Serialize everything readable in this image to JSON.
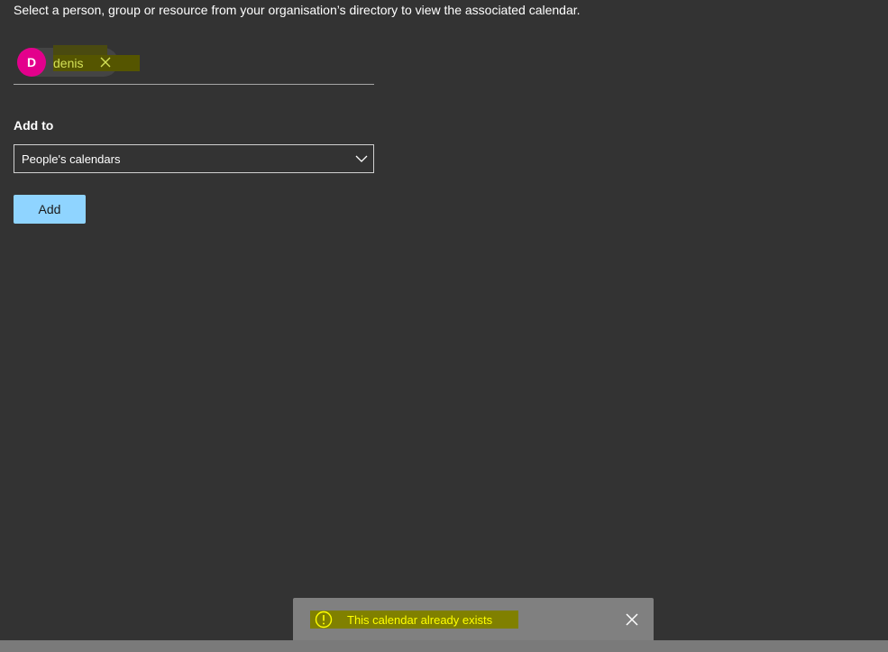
{
  "instruction": "Select a person, group or resource from your organisation’s directory to view the associated calendar.",
  "picker": {
    "selected": {
      "initial": "D",
      "name": "denis",
      "avatar_color": "#e3008c",
      "remove_icon": "close-icon"
    }
  },
  "add_to": {
    "label": "Add to",
    "selected_option": "People's calendars",
    "chevron_icon": "chevron-down-icon"
  },
  "add_button": {
    "label": "Add",
    "color": "#8fd4ff"
  },
  "toast": {
    "message": "This calendar already exists",
    "icon": "warning-icon",
    "close_icon": "close-icon"
  }
}
